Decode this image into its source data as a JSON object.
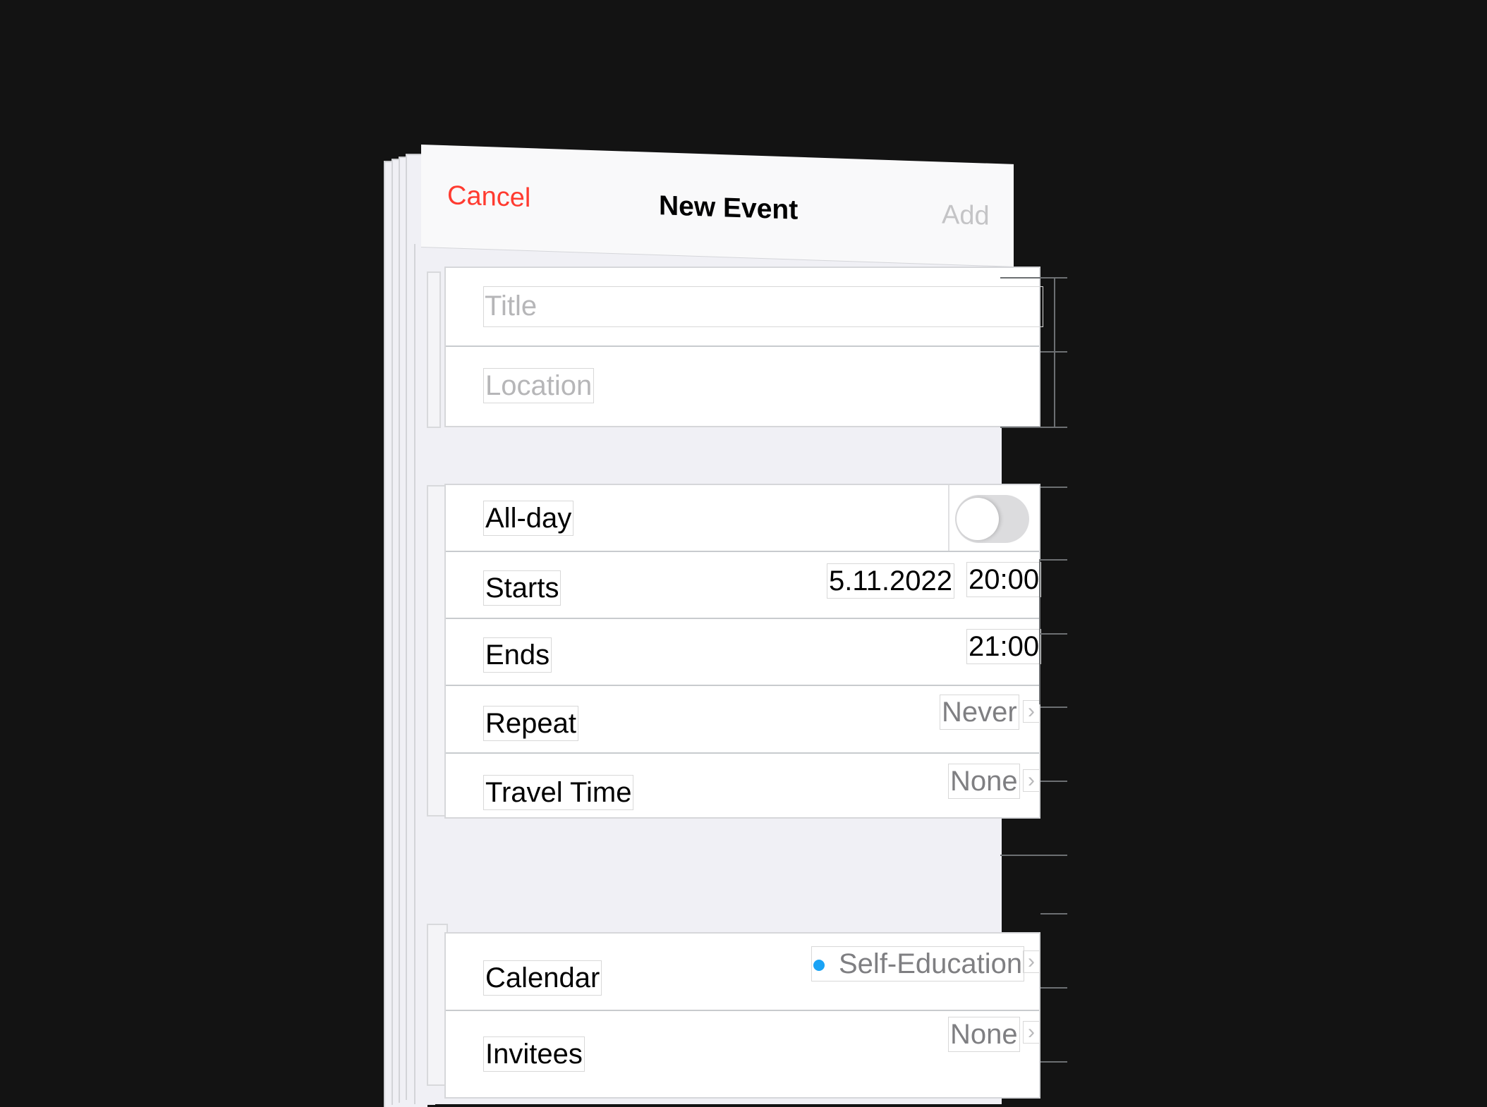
{
  "header": {
    "cancel_label": "Cancel",
    "title": "New Event",
    "add_label": "Add"
  },
  "colors": {
    "accent_red": "#ff3b30",
    "disabled_gray": "#c4c4c6",
    "calendar_dot": "#1aa3f5",
    "background": "#131313",
    "panel_gray": "#f0f0f5"
  },
  "fields": {
    "title_placeholder": "Title",
    "location_placeholder": "Location"
  },
  "rows": {
    "allday": {
      "label": "All-day",
      "toggle_on": false
    },
    "starts": {
      "label": "Starts",
      "date": "5.11.2022",
      "time": "20:00"
    },
    "ends": {
      "label": "Ends",
      "time": "21:00"
    },
    "repeat": {
      "label": "Repeat",
      "value": "Never",
      "chevron": "chevron-right-icon"
    },
    "travel": {
      "label": "Travel Time",
      "value": "None",
      "chevron": "chevron-right-icon"
    },
    "calendar": {
      "label": "Calendar",
      "value": "Self-Education",
      "chevron": "chevron-right-icon"
    },
    "invitees": {
      "label": "Invitees",
      "value": "None",
      "chevron": "chevron-right-icon"
    }
  },
  "icons": {
    "chevron_glyph": "›"
  }
}
